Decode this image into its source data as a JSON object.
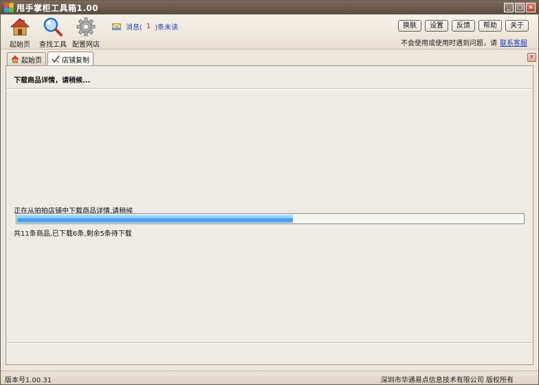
{
  "window": {
    "title": "甩手掌柜工具箱1.00",
    "controls": {
      "minimize": "_",
      "maximize": "□",
      "close": "×"
    }
  },
  "toolbar": {
    "tools": [
      {
        "label": "起始页",
        "icon": "home-icon"
      },
      {
        "label": "查找工具",
        "icon": "magnifier-icon"
      },
      {
        "label": "配置网店",
        "icon": "gear-icon"
      }
    ],
    "message": {
      "prefix": "消息(",
      "count": "1",
      "suffix": ")条未读",
      "icon": "envelope-icon"
    },
    "buttons": [
      "换肤",
      "设置",
      "反馈",
      "帮助",
      "关于"
    ],
    "help_text": "不会使用或使用时遇到问题，请",
    "help_link": "联系客服"
  },
  "tabs": [
    {
      "label": "起始页",
      "icon": "home-icon",
      "active": false
    },
    {
      "label": "店铺复制",
      "icon": "check-pen-icon",
      "active": true
    }
  ],
  "tab_close": "×",
  "content": {
    "heading": "下载商品详情，请稍候...",
    "progress_label": "正在从拍拍店铺中下载商品详情,请稍候",
    "progress": {
      "done": 6,
      "total": 11
    },
    "progress_status": "共11条商品,已下载6条,剩余5条待下载"
  },
  "status": {
    "version": "版本号1.00.31",
    "copyright": "深圳市华通易点信息技术有限公司 版权所有"
  },
  "colors": {
    "title_bar": "#5c4c3e",
    "progress_fill": "#3d97e8",
    "link": "#1f3fbf",
    "unread_count": "#d0201f"
  }
}
